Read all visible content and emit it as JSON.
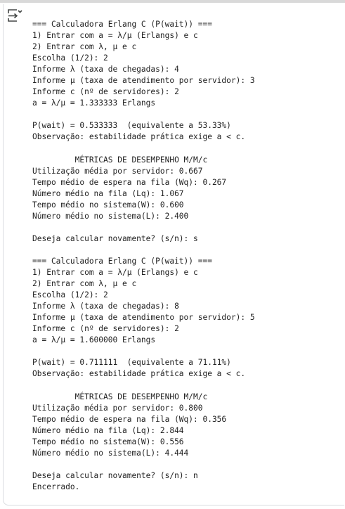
{
  "toolbar": {
    "output_icon": "output-collapse-icon"
  },
  "console": {
    "lines": [
      "=== Calculadora Erlang C (P(wait)) ===",
      "1) Entrar com a = λ/μ (Erlangs) e c",
      "2) Entrar com λ, μ e c",
      "Escolha (1/2): 2",
      "Informe λ (taxa de chegadas): 4",
      "Informe μ (taxa de atendimento por servidor): 3",
      "Informe c (nº de servidores): 2",
      "a = λ/μ = 1.333333 Erlangs",
      "",
      "P(wait) = 0.533333  (equivalente a 53.33%)",
      "Observação: estabilidade prática exige a < c.",
      "",
      "         MÉTRICAS DE DESEMPENHO M/M/c",
      "Utilização média por servidor: 0.667",
      "Tempo médio de espera na fila (Wq): 0.267",
      "Número médio na fila (Lq): 1.067",
      "Tempo médio no sistema(W): 0.600",
      "Número médio no sistema(L): 2.400",
      "",
      "Deseja calcular novamente? (s/n): s",
      "",
      "=== Calculadora Erlang C (P(wait)) ===",
      "1) Entrar com a = λ/μ (Erlangs) e c",
      "2) Entrar com λ, μ e c",
      "Escolha (1/2): 2",
      "Informe λ (taxa de chegadas): 8",
      "Informe μ (taxa de atendimento por servidor): 5",
      "Informe c (nº de servidores): 2",
      "a = λ/μ = 1.600000 Erlangs",
      "",
      "P(wait) = 0.711111  (equivalente a 71.11%)",
      "Observação: estabilidade prática exige a < c.",
      "",
      "         MÉTRICAS DE DESEMPENHO M/M/c",
      "Utilização média por servidor: 0.800",
      "Tempo médio de espera na fila (Wq): 0.356",
      "Número médio na fila (Lq): 2.844",
      "Tempo médio no sistema(W): 0.556",
      "Número médio no sistema(L): 4.444",
      "",
      "Deseja calcular novamente? (s/n): n",
      "Encerrado."
    ]
  }
}
